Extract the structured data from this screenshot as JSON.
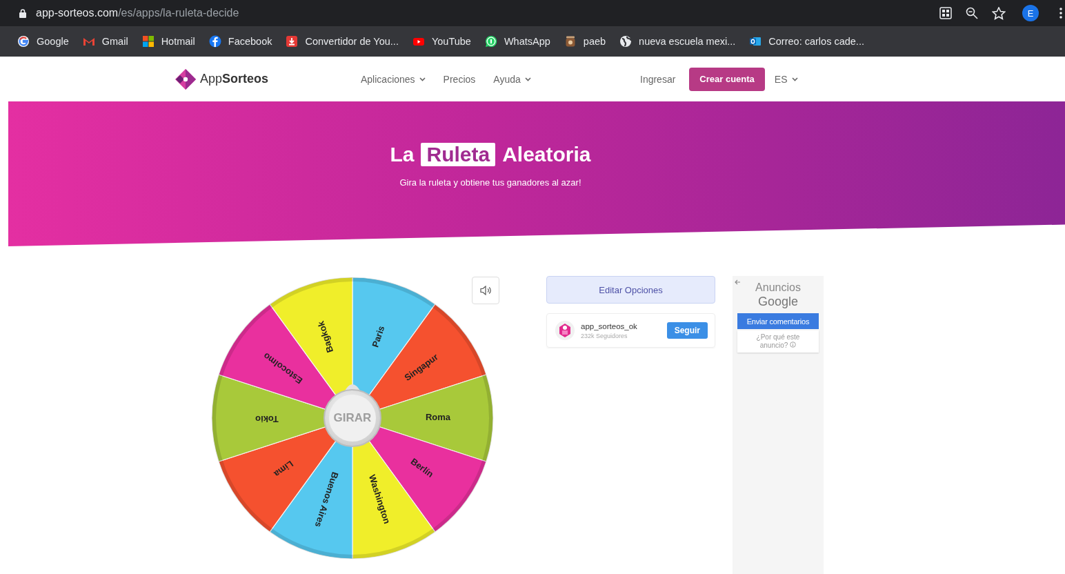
{
  "browser": {
    "url_host": "app-sorteos.com",
    "url_path": "/es/apps/la-ruleta-decide",
    "profile": "E"
  },
  "bookmarks": [
    {
      "label": "Google",
      "kind": "google"
    },
    {
      "label": "Gmail",
      "kind": "gmail"
    },
    {
      "label": "Hotmail",
      "kind": "windows"
    },
    {
      "label": "Facebook",
      "kind": "facebook"
    },
    {
      "label": "Convertidor de You...",
      "kind": "download"
    },
    {
      "label": "YouTube",
      "kind": "youtube"
    },
    {
      "label": "WhatsApp",
      "kind": "whatsapp"
    },
    {
      "label": "paeb",
      "kind": "jar"
    },
    {
      "label": "nueva escuela mexi...",
      "kind": "globe"
    },
    {
      "label": "Correo: carlos cade...",
      "kind": "outlook"
    }
  ],
  "nav": {
    "brand": "App**Sorteos**",
    "items": [
      {
        "label": "Aplicaciones",
        "dropdown": true
      },
      {
        "label": "Precios",
        "dropdown": false
      },
      {
        "label": "Ayuda",
        "dropdown": true
      }
    ],
    "login": "Ingresar",
    "signup": "Crear cuenta",
    "language": "ES"
  },
  "hero": {
    "title_start": "La",
    "title_highlight": "Ruleta",
    "title_end": "Aleatoria",
    "subtitle": "Gira la ruleta y obtiene tus ganadores al azar!"
  },
  "wheel": {
    "spin": "GIRAR",
    "segments": [
      {
        "label": "Paris",
        "color": "#56c8ef"
      },
      {
        "label": "Singapur",
        "color": "#f5512f"
      },
      {
        "label": "Roma",
        "color": "#a8c93a"
      },
      {
        "label": "Berlín",
        "color": "#e9309e"
      },
      {
        "label": "Washington",
        "color": "#f0ee2a"
      },
      {
        "label": "Buenos Aires",
        "color": "#56c8ef"
      },
      {
        "label": "Lima",
        "color": "#f5512f"
      },
      {
        "label": "Tokio",
        "color": "#a8c93a"
      },
      {
        "label": "Estocolmo",
        "color": "#e9309e"
      },
      {
        "label": "Bagkok",
        "color": "#f0ee2a"
      }
    ]
  },
  "options": {
    "edit": "Editar Opciones",
    "account": "app_sorteos_ok",
    "followers": "232k Seguidores",
    "follow": "Seguir"
  },
  "ads": {
    "title": "Anuncios",
    "brand": "Google",
    "feedback": "Enviar comentarios",
    "why": "¿Por qué este anuncio?"
  }
}
